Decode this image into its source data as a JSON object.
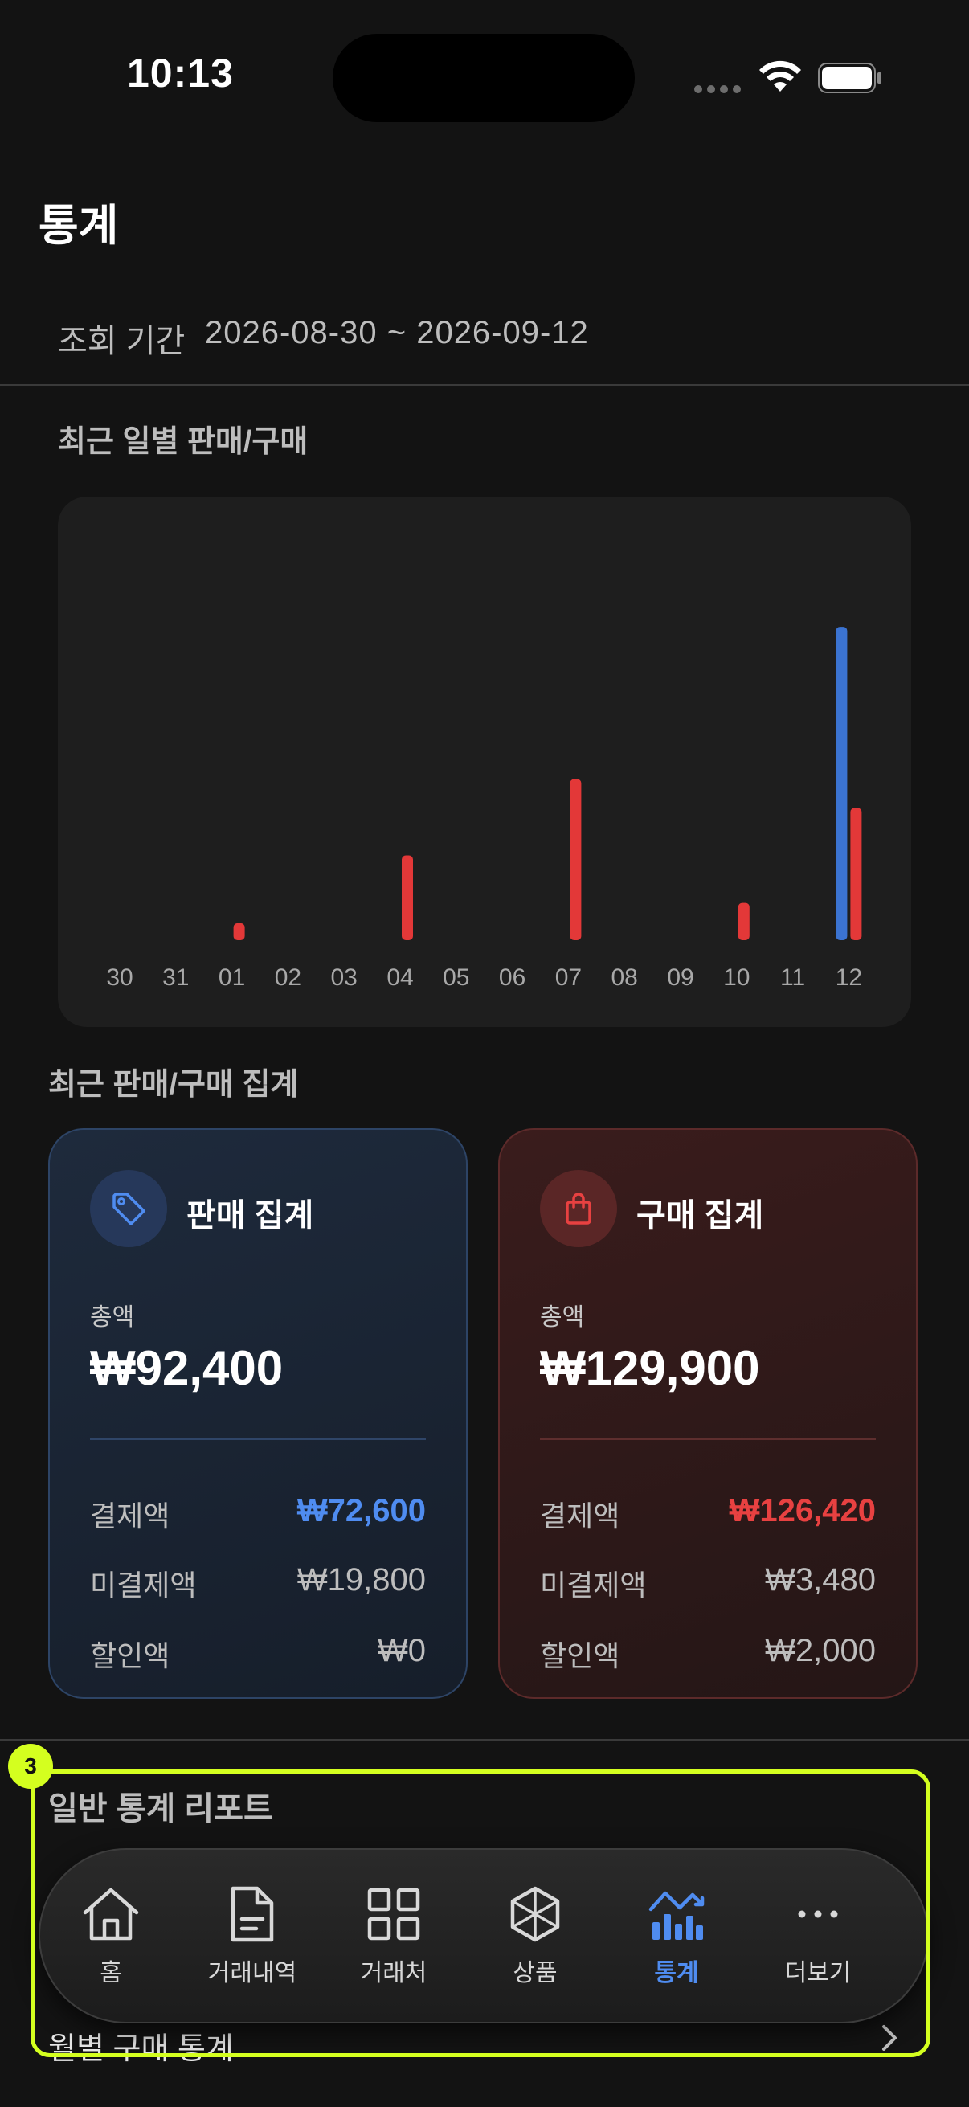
{
  "status_bar": {
    "time": "10:13"
  },
  "header": {
    "title": "통계",
    "period_label": "조회 기간",
    "period_value": "2026-08-30 ~ 2026-09-12"
  },
  "daily_section": {
    "title": "최근 일별 판매/구매"
  },
  "chart_data": {
    "type": "bar",
    "categories": [
      "30",
      "31",
      "01",
      "02",
      "03",
      "04",
      "05",
      "06",
      "07",
      "08",
      "09",
      "10",
      "11",
      "12"
    ],
    "series": [
      {
        "color": "#3b73d1",
        "values": [
          0,
          0,
          0,
          0,
          0,
          0,
          0,
          0,
          0,
          0,
          0,
          0,
          0,
          92400
        ]
      },
      {
        "color": "#e33838",
        "values": [
          0,
          0,
          5000,
          0,
          0,
          25000,
          0,
          0,
          47500,
          0,
          0,
          11000,
          0,
          39000
        ]
      }
    ],
    "ylim": [
      0,
      100000
    ],
    "grid": false,
    "legend": "none"
  },
  "summary_section": {
    "title": "최근 판매/구매 집계"
  },
  "sale_card": {
    "icon": "tag-icon",
    "title": "판매 집계",
    "total_label": "총액",
    "total_value": "₩92,400",
    "paid_label": "결제액",
    "paid_value": "₩72,600",
    "unpaid_label": "미결제액",
    "unpaid_value": "₩19,800",
    "discount_label": "할인액",
    "discount_value": "₩0",
    "accent": "#4f8cf0"
  },
  "buy_card": {
    "icon": "shopping-bag-icon",
    "title": "구매 집계",
    "total_label": "총액",
    "total_value": "₩129,900",
    "paid_label": "결제액",
    "paid_value": "₩126,420",
    "unpaid_label": "미결제액",
    "unpaid_value": "₩3,480",
    "discount_label": "할인액",
    "discount_value": "₩2,000",
    "accent": "#e84141"
  },
  "report_section": {
    "title": "일반 통계 리포트",
    "monthly_purchase": "월별 구매 통계"
  },
  "tabbar": {
    "items": [
      {
        "label": "홈",
        "icon": "home-icon"
      },
      {
        "label": "거래내역",
        "icon": "document-icon"
      },
      {
        "label": "거래처",
        "icon": "grid-icon"
      },
      {
        "label": "상품",
        "icon": "cube-icon"
      },
      {
        "label": "통계",
        "icon": "stats-icon",
        "active": true
      },
      {
        "label": "더보기",
        "icon": "more-icon"
      }
    ]
  },
  "annotation": {
    "badge": "3"
  }
}
